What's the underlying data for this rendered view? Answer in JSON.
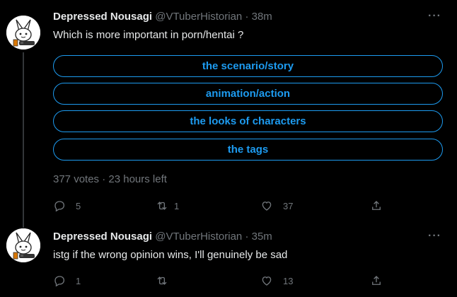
{
  "tweets": [
    {
      "name": "Depressed Nousagi",
      "handle": "@VTuberHistorian",
      "separator": "·",
      "time": "38m",
      "text": "Which is more important in porn/hentai ?",
      "poll": {
        "options": [
          "the scenario/story",
          "animation/action",
          "the looks of characters",
          "the tags"
        ],
        "votes": "377 votes",
        "separator": "·",
        "time_left": "23 hours left"
      },
      "actions": {
        "replies": "5",
        "retweets": "1",
        "likes": "37"
      }
    },
    {
      "name": "Depressed Nousagi",
      "handle": "@VTuberHistorian",
      "separator": "·",
      "time": "35m",
      "text": "istg if the wrong opinion wins, I'll genuinely be sad",
      "actions": {
        "replies": "1",
        "retweets": "",
        "likes": "13"
      }
    }
  ],
  "more_label": "···",
  "icons": {
    "reply": "reply-icon",
    "retweet": "retweet-icon",
    "like": "heart-icon",
    "share": "share-icon"
  },
  "colors": {
    "accent": "#1d9bf0",
    "muted": "#71767b",
    "text": "#e7e9ea",
    "background": "#000000"
  }
}
